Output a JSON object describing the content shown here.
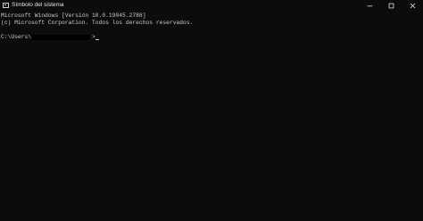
{
  "window": {
    "title": "Símbolo del sistema",
    "icon": "cmd-icon"
  },
  "window_controls": {
    "minimize_icon": "minimize-icon",
    "maximize_icon": "maximize-icon",
    "close_icon": "close-icon"
  },
  "console": {
    "line1": "Microsoft Windows [Versión 10.0.19045.2788]",
    "line2": "(c) Microsoft Corporation. Todos los derechos reservados.",
    "prompt_prefix": "C:\\Users\\",
    "prompt_suffix": ">"
  },
  "colors": {
    "background": "#0c0c0c",
    "text": "#cccccc",
    "title_text": "#e6e6e6"
  }
}
